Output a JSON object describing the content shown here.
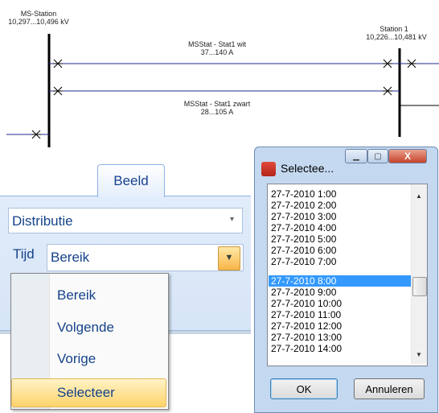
{
  "network": {
    "station_left_name": "MS-Station",
    "station_left_range": "10,297...10,496 kV",
    "station_right_name": "Station 1",
    "station_right_range": "10,226...10,481 kV",
    "line1_name": "MSStat - Stat1 wit",
    "line1_range": "37...140 A",
    "line2_name": "MSStat - Stat1 zwart",
    "line2_range": "28...105 A"
  },
  "ribbon": {
    "tab_label": "Beeld",
    "combo1_value": "Distributie",
    "tijd_label": "Tijd",
    "combo2_value": "Bereik",
    "menu_items": [
      "Bereik",
      "Volgende",
      "Vorige",
      "Selecteer"
    ],
    "highlighted_item": "Selecteer"
  },
  "dialog": {
    "title": "Selectee...",
    "items": [
      "27-7-2010 1:00",
      "27-7-2010 2:00",
      "27-7-2010 3:00",
      "27-7-2010 4:00",
      "27-7-2010 5:00",
      "27-7-2010 6:00",
      "27-7-2010 7:00",
      "27-7-2010 8:00",
      "27-7-2010 9:00",
      "27-7-2010 10:00",
      "27-7-2010 11:00",
      "27-7-2010 12:00",
      "27-7-2010 13:00",
      "27-7-2010 14:00"
    ],
    "selected_item": "27-7-2010 8:00",
    "ok_label": "OK",
    "cancel_label": "Annuleren"
  },
  "colors": {
    "line": "#1f2b8f",
    "accent": "#15428b",
    "selection": "#3399ff"
  }
}
